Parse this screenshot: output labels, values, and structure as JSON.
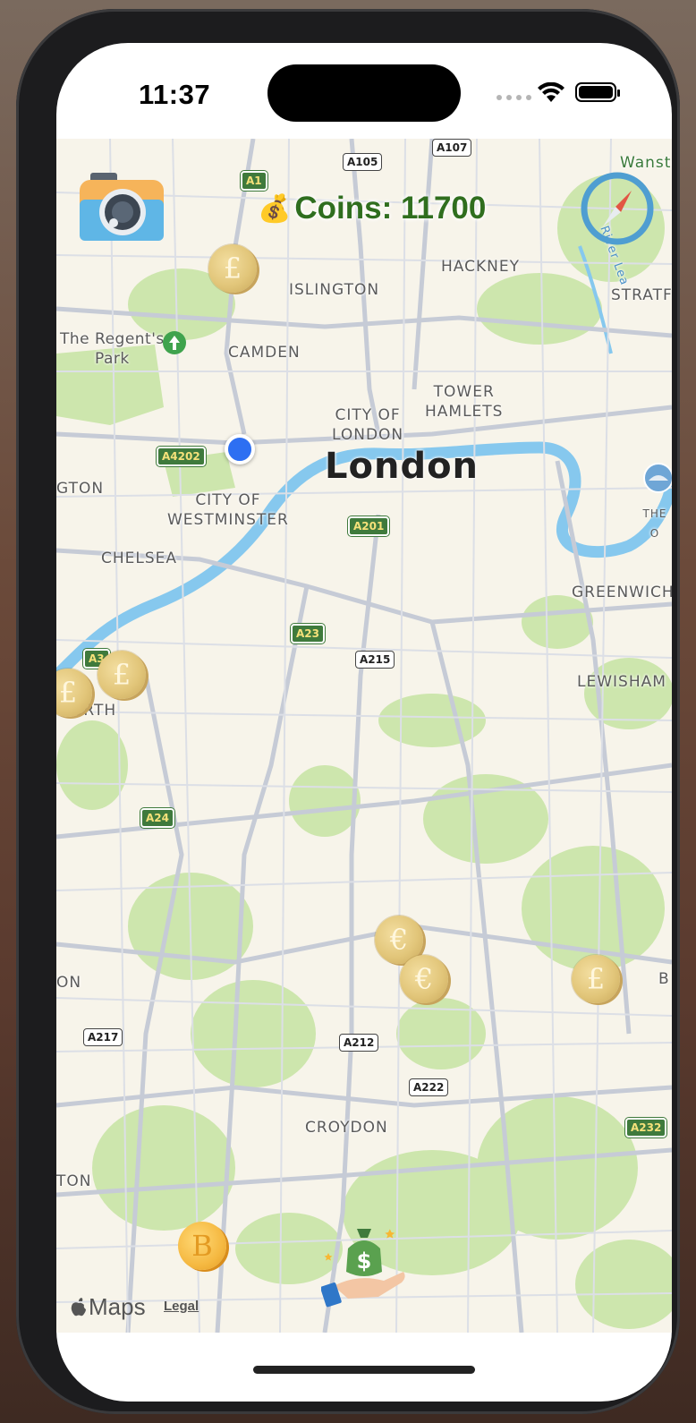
{
  "status_bar": {
    "time": "11:37"
  },
  "hud": {
    "coins_icon": "money-bag-icon",
    "coins_label": "Coins: 11700"
  },
  "map": {
    "place_labels": {
      "london": "London",
      "islington": "ISLINGTON",
      "hackney": "HACKNEY",
      "stratford": "STRATFO",
      "regents_park": "The Regent's\nPark",
      "camden": "CAMDEN",
      "tower_hamlets": "TOWER\nHAMLETS",
      "city_of_london": "CITY OF\nLONDON",
      "city_of_westminster": "CITY OF\nWESTMINSTER",
      "kensington_partial": "GTON",
      "chelsea": "CHELSEA",
      "greenwich": "GREENWICH",
      "lewisham": "LEWISHAM",
      "wandsworth_partial": "ORTH",
      "croydon": "CROYDON",
      "left_partial_1": "ON",
      "left_partial_2": "TON",
      "right_partial_b": "B",
      "the_o2_partial": "THE O",
      "wanstead_partial": "Wanste",
      "river_lea": "River Lea"
    },
    "road_shields": {
      "a1": "A1",
      "a105": "A105",
      "a107": "A107",
      "a4202": "A4202",
      "a201": "A201",
      "a23": "A23",
      "a215": "A215",
      "a3": "A3",
      "a24": "A24",
      "a217": "A217",
      "a212": "A212",
      "a222": "A222",
      "a232": "A232"
    },
    "coins": [
      {
        "symbol": "£",
        "kind": "pound"
      },
      {
        "symbol": "£",
        "kind": "pound"
      },
      {
        "symbol": "£",
        "kind": "pound"
      },
      {
        "symbol": "€",
        "kind": "euro"
      },
      {
        "symbol": "€",
        "kind": "euro"
      },
      {
        "symbol": "£",
        "kind": "pound"
      },
      {
        "symbol": "B",
        "kind": "bitcoin"
      }
    ],
    "attribution": {
      "brand": "Maps",
      "legal": "Legal"
    }
  },
  "colors": {
    "coin_text": "#2f6e1e",
    "user_location": "#2d6ff2",
    "river": "#7ec4ee",
    "park": "#c8e6a6"
  }
}
